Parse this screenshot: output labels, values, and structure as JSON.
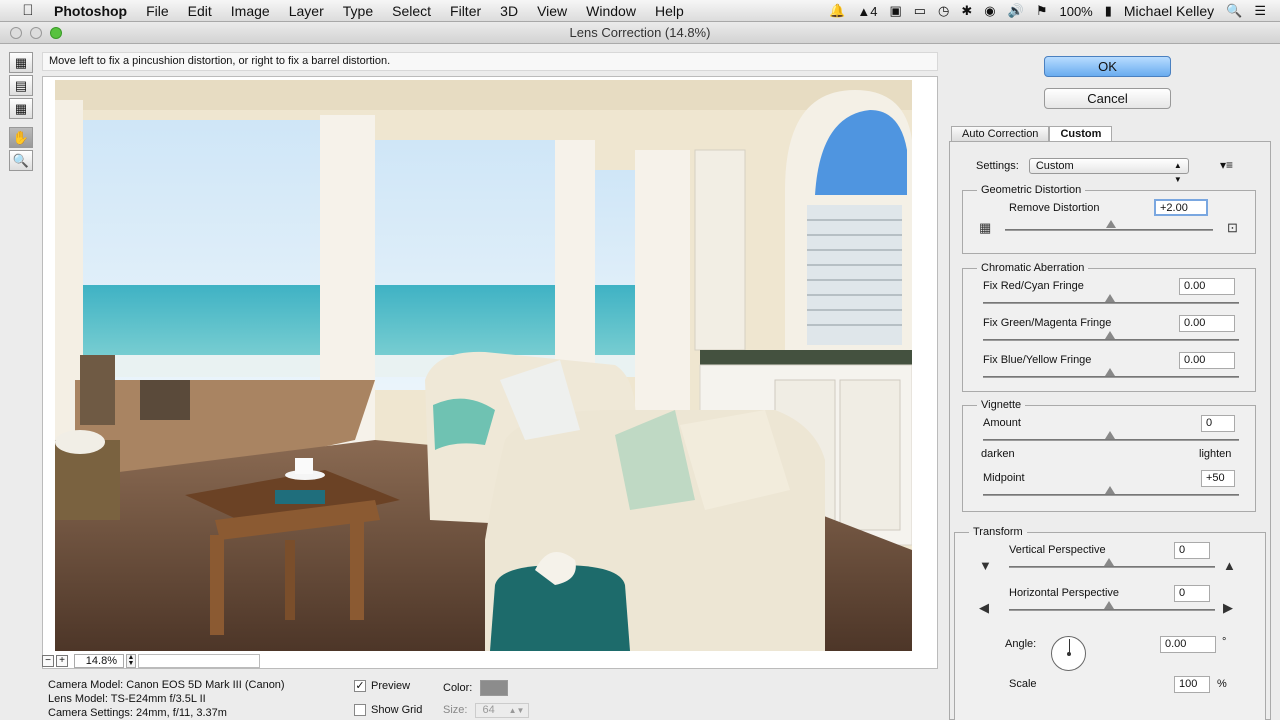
{
  "menubar": {
    "app_name": "Photoshop",
    "items": [
      "File",
      "Edit",
      "Image",
      "Layer",
      "Type",
      "Select",
      "Filter",
      "3D",
      "View",
      "Window",
      "Help"
    ],
    "battery": "100%",
    "user": "Michael Kelley",
    "adobe_count": "4"
  },
  "window": {
    "title": "Lens Correction (14.8%)"
  },
  "hint": "Move left to fix a pincushion distortion, or right to fix a barrel distortion.",
  "zoom": {
    "value": "14.8%"
  },
  "camera": {
    "model": "Camera Model: Canon EOS 5D Mark III (Canon)",
    "lens": "Lens Model: TS-E24mm f/3.5L II",
    "settings": "Camera Settings: 24mm, f/11, 3.37m"
  },
  "preview_options": {
    "preview_label": "Preview",
    "preview_checked": true,
    "grid_label": "Show Grid",
    "grid_checked": false,
    "color_label": "Color:",
    "color_value": "#8c8c8c",
    "size_label": "Size:",
    "size_value": "64"
  },
  "buttons": {
    "ok": "OK",
    "cancel": "Cancel"
  },
  "tabs": {
    "auto": "Auto Correction",
    "custom": "Custom"
  },
  "settings": {
    "label": "Settings:",
    "value": "Custom"
  },
  "geometric": {
    "title": "Geometric Distortion",
    "remove_label": "Remove Distortion",
    "remove_value": "+2.00"
  },
  "chromatic": {
    "title": "Chromatic Aberration",
    "red_cyan_label": "Fix Red/Cyan Fringe",
    "red_cyan_value": "0.00",
    "green_magenta_label": "Fix Green/Magenta Fringe",
    "green_magenta_value": "0.00",
    "blue_yellow_label": "Fix Blue/Yellow Fringe",
    "blue_yellow_value": "0.00"
  },
  "vignette": {
    "title": "Vignette",
    "amount_label": "Amount",
    "amount_value": "0",
    "darken": "darken",
    "lighten": "lighten",
    "midpoint_label": "Midpoint",
    "midpoint_value": "+50"
  },
  "transform": {
    "title": "Transform",
    "vertical_label": "Vertical Perspective",
    "vertical_value": "0",
    "horizontal_label": "Horizontal Perspective",
    "horizontal_value": "0",
    "angle_label": "Angle:",
    "angle_value": "0.00",
    "angle_unit": "°",
    "scale_label": "Scale",
    "scale_value": "100",
    "scale_unit": "%"
  }
}
